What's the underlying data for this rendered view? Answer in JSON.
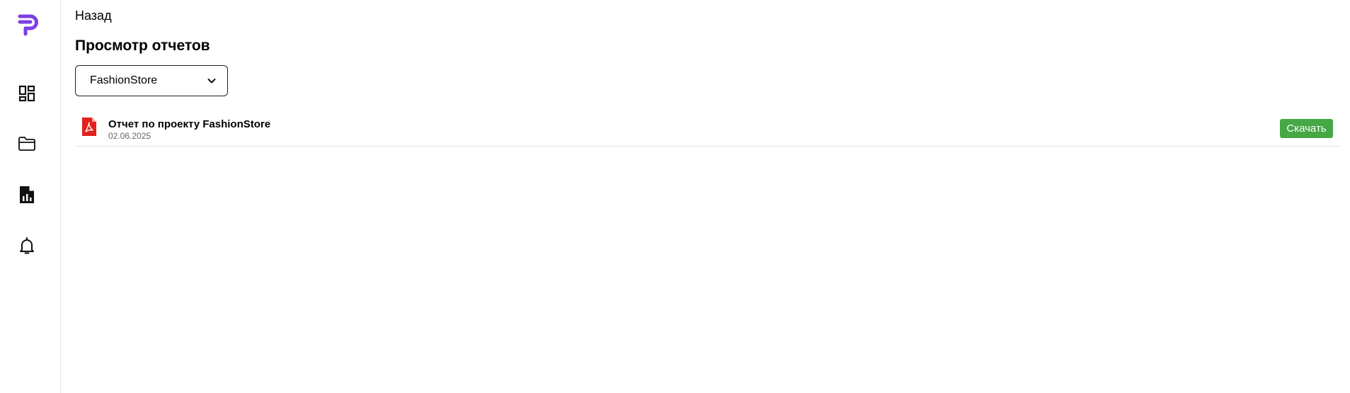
{
  "brand": {
    "accent": "#7b3fe4"
  },
  "sidebar": {
    "items": [
      {
        "name": "dashboard",
        "icon": "dashboard-icon"
      },
      {
        "name": "projects",
        "icon": "folder-icon"
      },
      {
        "name": "reports",
        "icon": "report-document-icon"
      },
      {
        "name": "notifications",
        "icon": "bell-icon"
      }
    ]
  },
  "header": {
    "back_label": "Назад",
    "title": "Просмотр отчетов"
  },
  "project_select": {
    "selected": "FashionStore"
  },
  "reports": [
    {
      "name": "Отчет по проекту FashionStore",
      "date": "02.06.2025",
      "action_label": "Скачать",
      "file_icon": "pdf-icon"
    }
  ],
  "colors": {
    "download_button": "#45a845",
    "pdf_icon": "#e3201b"
  }
}
